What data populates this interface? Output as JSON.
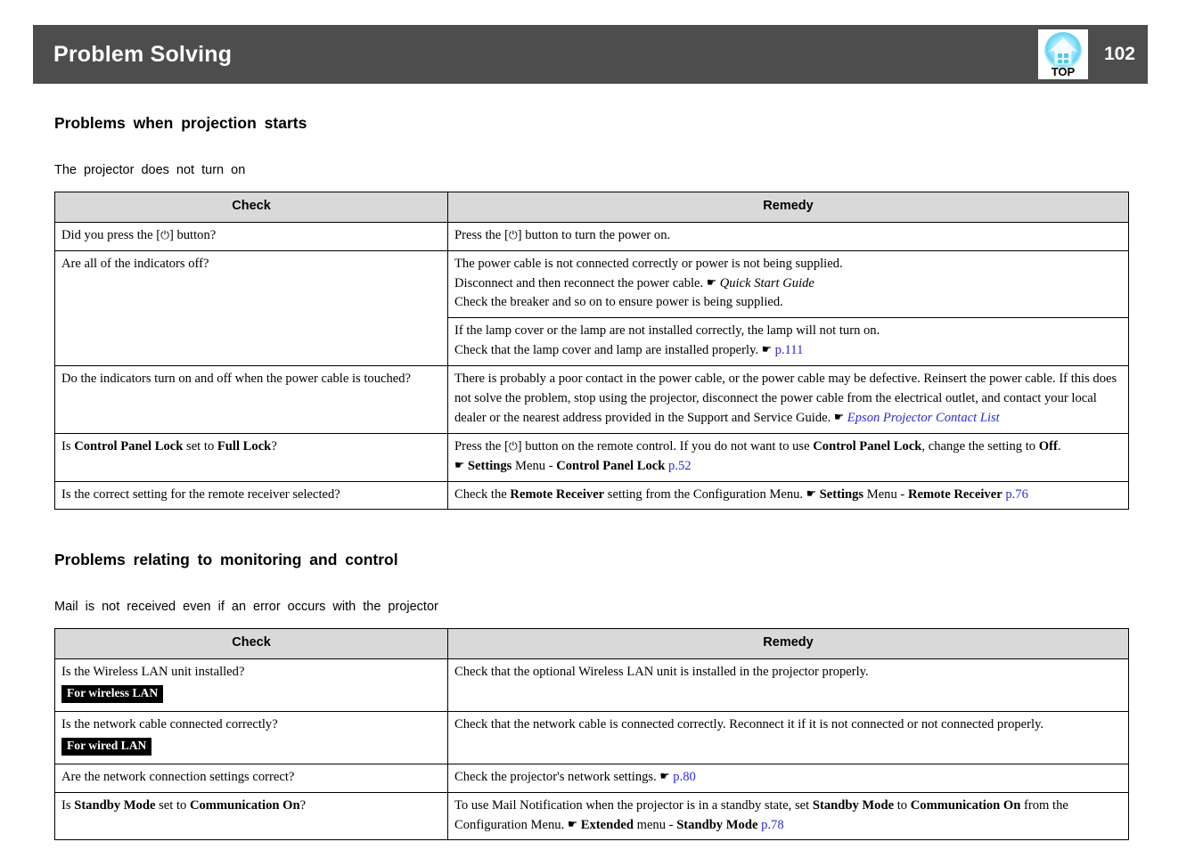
{
  "header": {
    "title": "Problem Solving",
    "page_number": "102",
    "top_icon_label": "TOP",
    "bar_color": "#4d4d4d",
    "icon_glow_color": "#6fd8f5"
  },
  "link_color": "#2a2ad6",
  "table_header_bg": "#d9d9d9",
  "sections": [
    {
      "heading": "Problems when projection starts",
      "subheading": "The projector does not turn on",
      "columns": {
        "check": "Check",
        "remedy": "Remedy"
      },
      "rows": [
        {
          "check_lines": [
            [
              {
                "t": "Did you press the ["
              },
              {
                "t": "⏻",
                "s": "pwr"
              },
              {
                "t": "] button?"
              }
            ]
          ],
          "remedy_blocks": [
            [
              [
                {
                  "t": "Press the ["
                },
                {
                  "t": "⏻",
                  "s": "pwr"
                },
                {
                  "t": "] button to turn the power on."
                }
              ]
            ]
          ]
        },
        {
          "check_lines": [
            [
              {
                "t": "Are all of the indicators off?"
              }
            ]
          ],
          "remedy_blocks": [
            [
              [
                {
                  "t": "The power cable is not connected correctly or power is not being supplied."
                }
              ],
              [
                {
                  "t": "Disconnect and then reconnect the power cable. "
                },
                {
                  "t": "☛",
                  "s": "hand"
                },
                {
                  "t": " "
                },
                {
                  "t": "Quick Start Guide",
                  "s": "ital"
                }
              ],
              [
                {
                  "t": "Check the breaker and so on to ensure power is being supplied."
                }
              ]
            ],
            [
              [
                {
                  "t": "If the lamp cover or the lamp are not installed correctly, the lamp will not turn on."
                }
              ],
              [
                {
                  "t": "Check that the lamp cover and lamp are installed properly. "
                },
                {
                  "t": "☛",
                  "s": "hand"
                },
                {
                  "t": " "
                },
                {
                  "t": "p.111",
                  "s": "link"
                }
              ]
            ]
          ]
        },
        {
          "check_lines": [
            [
              {
                "t": "Do the indicators turn on and off when the power cable is touched?"
              }
            ]
          ],
          "remedy_blocks": [
            [
              [
                {
                  "t": "There is probably a poor contact in the power cable, or the power cable may be defective. Reinsert the power cable. If this does not solve the problem, stop using the projector, disconnect the power cable from the electrical outlet, and contact your local dealer or the nearest address provided in the Support and Service Guide. "
                },
                {
                  "t": "☛",
                  "s": "hand"
                },
                {
                  "t": " "
                },
                {
                  "t": "Epson Projector Contact List",
                  "s": "link-ital"
                }
              ]
            ]
          ]
        },
        {
          "check_lines": [
            [
              {
                "t": "Is "
              },
              {
                "t": "Control Panel Lock",
                "s": "bold"
              },
              {
                "t": " set to "
              },
              {
                "t": "Full Lock",
                "s": "bold"
              },
              {
                "t": "?"
              }
            ]
          ],
          "remedy_blocks": [
            [
              [
                {
                  "t": "Press the ["
                },
                {
                  "t": "⏻",
                  "s": "pwr"
                },
                {
                  "t": "] button on the remote control. If you do not want to use "
                },
                {
                  "t": "Control Panel Lock",
                  "s": "bold"
                },
                {
                  "t": ", change the setting to "
                },
                {
                  "t": "Off",
                  "s": "bold"
                },
                {
                  "t": "."
                }
              ],
              [
                {
                  "t": "☛",
                  "s": "hand"
                },
                {
                  "t": " "
                },
                {
                  "t": "Settings",
                  "s": "bold"
                },
                {
                  "t": " Menu - "
                },
                {
                  "t": "Control Panel Lock",
                  "s": "bold"
                },
                {
                  "t": " "
                },
                {
                  "t": "p.52",
                  "s": "link"
                }
              ]
            ]
          ]
        },
        {
          "check_lines": [
            [
              {
                "t": "Is the correct setting for the remote receiver selected?"
              }
            ]
          ],
          "remedy_blocks": [
            [
              [
                {
                  "t": "Check the "
                },
                {
                  "t": "Remote Receiver",
                  "s": "bold"
                },
                {
                  "t": " setting from the Configuration Menu. "
                },
                {
                  "t": "☛",
                  "s": "hand"
                },
                {
                  "t": " "
                },
                {
                  "t": "Settings",
                  "s": "bold"
                },
                {
                  "t": " Menu - "
                },
                {
                  "t": "Remote Receiver",
                  "s": "bold"
                },
                {
                  "t": " "
                },
                {
                  "t": "p.76",
                  "s": "link"
                }
              ]
            ]
          ]
        }
      ]
    },
    {
      "heading": "Problems relating to monitoring and control",
      "subheading": "Mail is not received even if an error occurs with the projector",
      "columns": {
        "check": "Check",
        "remedy": "Remedy"
      },
      "rows": [
        {
          "check_lines": [
            [
              {
                "t": "Is the Wireless LAN unit installed?"
              }
            ]
          ],
          "badge": "For wireless LAN",
          "remedy_blocks": [
            [
              [
                {
                  "t": "Check that the optional Wireless LAN unit is installed in the projector properly."
                }
              ]
            ]
          ]
        },
        {
          "check_lines": [
            [
              {
                "t": "Is the network cable connected correctly?"
              }
            ]
          ],
          "badge": "For wired LAN",
          "remedy_blocks": [
            [
              [
                {
                  "t": "Check that the network cable is connected correctly. Reconnect it if it is not connected or not connected properly."
                }
              ]
            ]
          ]
        },
        {
          "check_lines": [
            [
              {
                "t": "Are the network connection settings correct?"
              }
            ]
          ],
          "remedy_blocks": [
            [
              [
                {
                  "t": "Check the projector's network settings. "
                },
                {
                  "t": "☛",
                  "s": "hand"
                },
                {
                  "t": " "
                },
                {
                  "t": "p.80",
                  "s": "link"
                }
              ]
            ]
          ]
        },
        {
          "check_lines": [
            [
              {
                "t": "Is "
              },
              {
                "t": "Standby Mode",
                "s": "bold"
              },
              {
                "t": " set to "
              },
              {
                "t": "Communication On",
                "s": "bold"
              },
              {
                "t": "?"
              }
            ]
          ],
          "remedy_blocks": [
            [
              [
                {
                  "t": "To use Mail Notification when the projector is in a standby state, set "
                },
                {
                  "t": "Standby Mode",
                  "s": "bold"
                },
                {
                  "t": " to "
                },
                {
                  "t": "Communication On",
                  "s": "bold"
                },
                {
                  "t": " from the Configuration Menu. "
                },
                {
                  "t": "☛",
                  "s": "hand"
                },
                {
                  "t": " "
                },
                {
                  "t": "Extended",
                  "s": "bold"
                },
                {
                  "t": " menu - "
                },
                {
                  "t": "Standby Mode",
                  "s": "bold"
                },
                {
                  "t": " "
                },
                {
                  "t": "p.78",
                  "s": "link"
                }
              ]
            ]
          ]
        }
      ]
    }
  ]
}
